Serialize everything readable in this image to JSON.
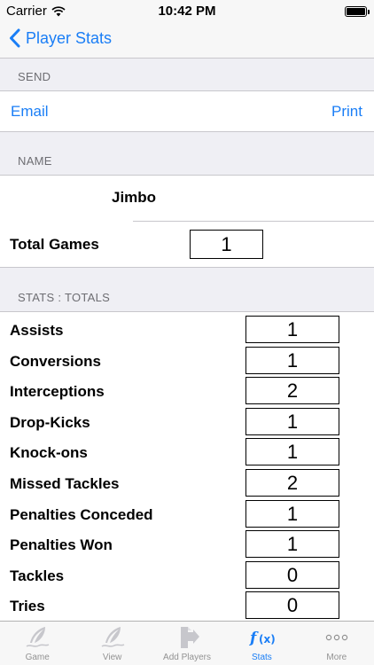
{
  "status_bar": {
    "carrier": "Carrier",
    "time": "10:42 PM"
  },
  "nav": {
    "back_label": "Player Stats"
  },
  "send": {
    "header": "SEND",
    "email_label": "Email",
    "print_label": "Print"
  },
  "name_section": {
    "header": "NAME",
    "player_name": "Jimbo"
  },
  "total_games": {
    "label": "Total Games",
    "value": "1"
  },
  "stats": {
    "header": "STATS : TOTALS",
    "rows": [
      {
        "label": "Assists",
        "value": "1"
      },
      {
        "label": "Conversions",
        "value": "1"
      },
      {
        "label": "Interceptions",
        "value": "2"
      },
      {
        "label": "Drop-Kicks",
        "value": "1"
      },
      {
        "label": "Knock-ons",
        "value": "1"
      },
      {
        "label": "Missed Tackles",
        "value": "2"
      },
      {
        "label": "Penalties Conceded",
        "value": "1"
      },
      {
        "label": "Penalties Won",
        "value": "1"
      },
      {
        "label": "Tackles",
        "value": "0"
      },
      {
        "label": "Tries",
        "value": "0"
      }
    ]
  },
  "tab_bar": {
    "tabs": [
      {
        "label": "Game",
        "icon": "quill-icon"
      },
      {
        "label": "View",
        "icon": "quill-icon"
      },
      {
        "label": "Add Players",
        "icon": "add-players-icon"
      },
      {
        "label": "Stats",
        "icon": "function-icon"
      },
      {
        "label": "More",
        "icon": "more-icon"
      }
    ],
    "active": "Stats"
  },
  "colors": {
    "accent": "#1a7ef6",
    "group_background": "#efeff4",
    "separator": "#c8c7cc"
  }
}
